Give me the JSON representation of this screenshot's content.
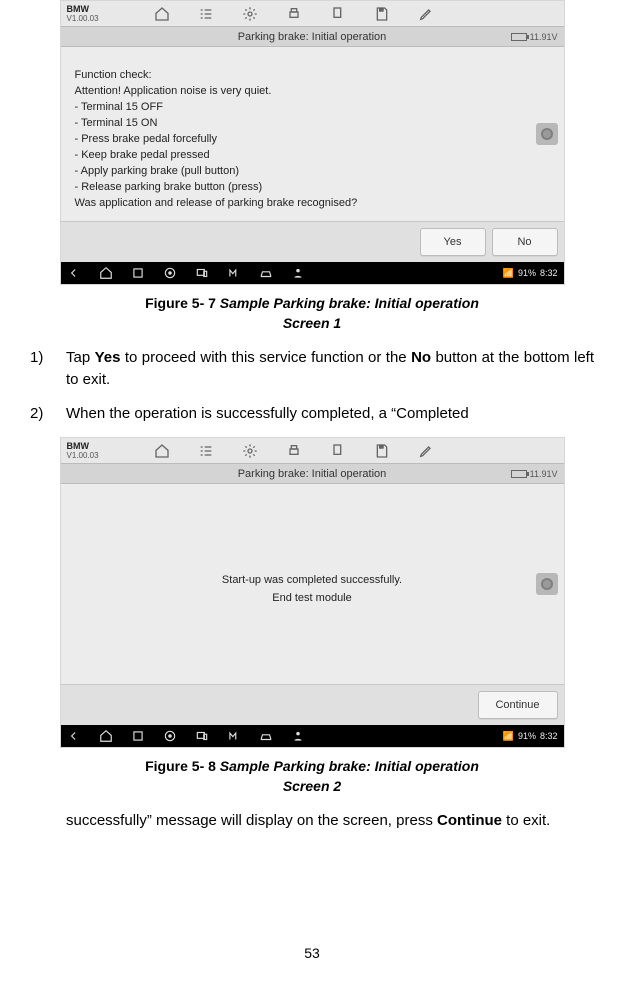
{
  "page_number": "53",
  "figure1": {
    "caption_lead": "Figure 5- 7 ",
    "caption_rest": "Sample Parking brake: Initial operation",
    "caption_line2": "Screen 1"
  },
  "figure2": {
    "caption_lead": "Figure 5- 8 ",
    "caption_rest": "Sample Parking brake: Initial operation",
    "caption_line2": "Screen 2"
  },
  "step1": {
    "num": "1)",
    "pre": "Tap ",
    "bold1": "Yes",
    "mid": " to proceed with this service function or the ",
    "bold2": "No",
    "post": " button at the bottom left to exit."
  },
  "step2": {
    "num": "2)",
    "text": " When the operation is successfully completed, a “Completed "
  },
  "cont": {
    "pre": "successfully” message will display on the screen, press ",
    "bold": "Continue",
    "post": " to exit."
  },
  "screen1": {
    "brand": "BMW",
    "version": "V1.00.03",
    "title": "Parking brake: Initial operation",
    "battery": "11.91V",
    "lines": {
      "l0": "Function check:",
      "l1": "Attention! Application noise is very quiet.",
      "l2": "- Terminal 15 OFF",
      "l3": "- Terminal 15 ON",
      "l4": "- Press brake pedal forcefully",
      "l5": "- Keep brake pedal pressed",
      "l6": "- Apply parking brake (pull button)",
      "l7": "- Release parking brake button (press)",
      "l8": "Was application and release of parking brake recognised?"
    },
    "btn_yes": "Yes",
    "btn_no": "No",
    "clock_pct": "91%",
    "clock_time": "8:32"
  },
  "screen2": {
    "brand": "BMW",
    "version": "V1.00.03",
    "title": "Parking brake: Initial operation",
    "battery": "11.91V",
    "msg_line1": "Start-up was completed successfully.",
    "msg_line2": "End test module",
    "btn_continue": "Continue",
    "clock_pct": "91%",
    "clock_time": "8:32"
  }
}
